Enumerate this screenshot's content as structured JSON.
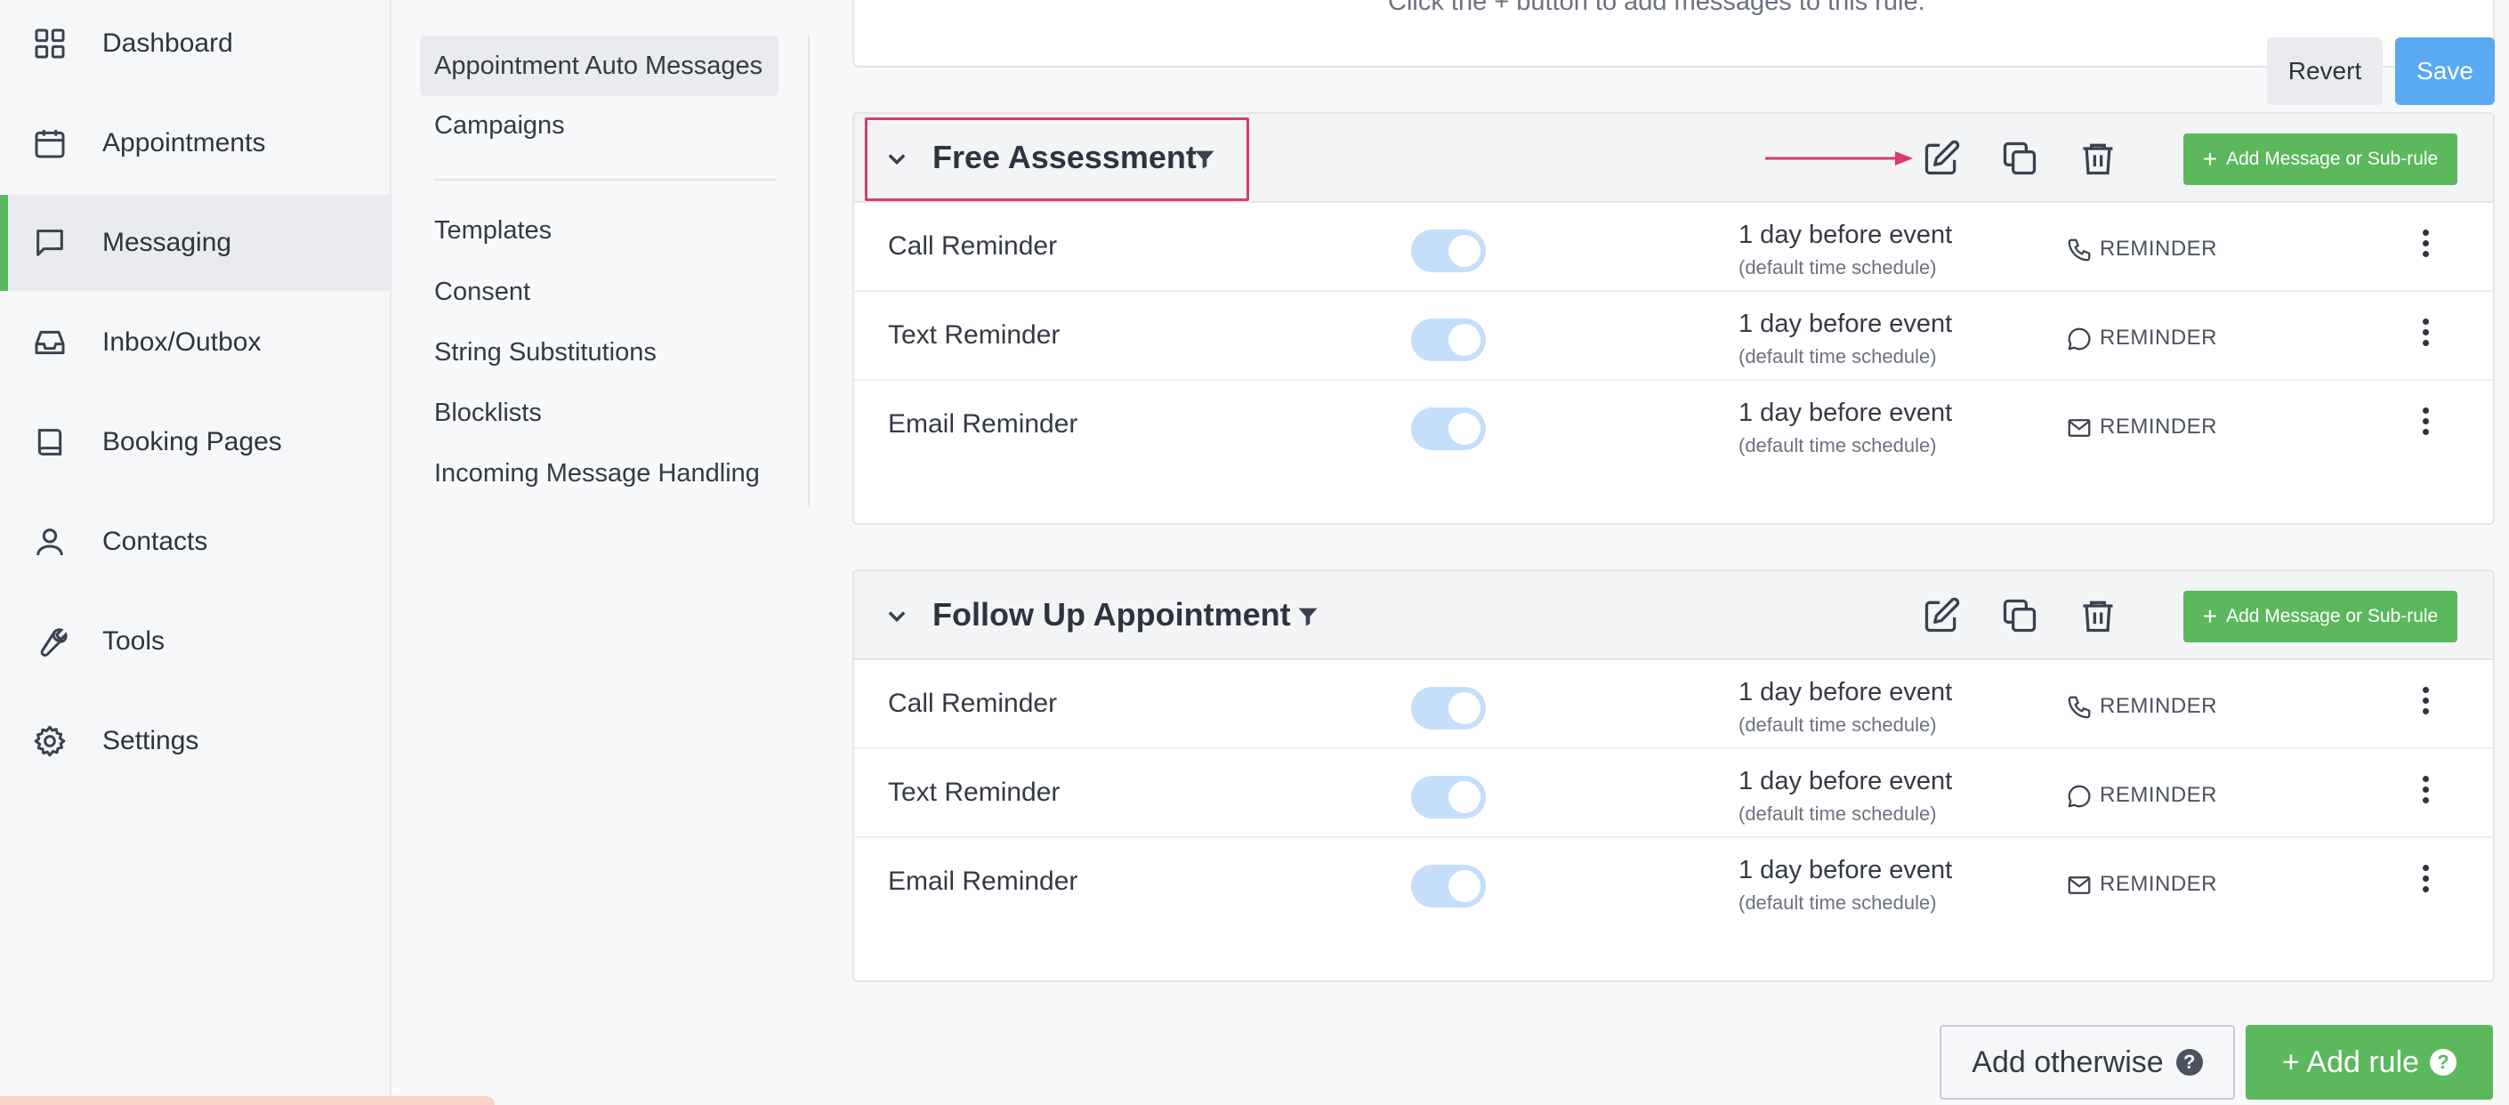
{
  "sidebar": {
    "items": [
      {
        "label": "Dashboard",
        "icon": "dashboard-icon"
      },
      {
        "label": "Appointments",
        "icon": "calendar-icon"
      },
      {
        "label": "Messaging",
        "icon": "message-icon",
        "active": true
      },
      {
        "label": "Inbox/Outbox",
        "icon": "inbox-icon"
      },
      {
        "label": "Booking Pages",
        "icon": "book-icon"
      },
      {
        "label": "Contacts",
        "icon": "user-icon"
      },
      {
        "label": "Tools",
        "icon": "wrench-icon"
      },
      {
        "label": "Settings",
        "icon": "gear-icon"
      }
    ]
  },
  "subnav": {
    "group1": [
      "Appointment Auto Messages",
      "Campaigns"
    ],
    "group2": [
      "Templates",
      "Consent",
      "String Substitutions",
      "Blocklists",
      "Incoming Message Handling"
    ]
  },
  "top": {
    "hint": "Click the  +  button to add messages to this rule.",
    "revert_label": "Revert",
    "save_label": "Save"
  },
  "rules": [
    {
      "title": "Free Assessment",
      "add_label": "Add Message or Sub-rule",
      "messages": [
        {
          "name": "Call Reminder",
          "timing": "1 day before event",
          "schedule": "(default time schedule)",
          "type": "REMINDER",
          "icon": "phone-icon",
          "enabled": true
        },
        {
          "name": "Text Reminder",
          "timing": "1 day before event",
          "schedule": "(default time schedule)",
          "type": "REMINDER",
          "icon": "chat-icon",
          "enabled": true
        },
        {
          "name": "Email Reminder",
          "timing": "1 day before event",
          "schedule": "(default time schedule)",
          "type": "REMINDER",
          "icon": "mail-icon",
          "enabled": true
        }
      ]
    },
    {
      "title": "Follow Up Appointment",
      "add_label": "Add Message or Sub-rule",
      "messages": [
        {
          "name": "Call Reminder",
          "timing": "1 day before event",
          "schedule": "(default time schedule)",
          "type": "REMINDER",
          "icon": "phone-icon",
          "enabled": true
        },
        {
          "name": "Text Reminder",
          "timing": "1 day before event",
          "schedule": "(default time schedule)",
          "type": "REMINDER",
          "icon": "chat-icon",
          "enabled": true
        },
        {
          "name": "Email Reminder",
          "timing": "1 day before event",
          "schedule": "(default time schedule)",
          "type": "REMINDER",
          "icon": "mail-icon",
          "enabled": true
        }
      ]
    }
  ],
  "footer": {
    "otherwise_label": "Add otherwise",
    "add_rule_label": "+ Add rule",
    "help_glyph": "?"
  },
  "colors": {
    "accent_green": "#5cb85c",
    "save_blue": "#5aa9f3",
    "highlight_pink": "#dc3a6a",
    "toggle_on": "#c5def9"
  }
}
